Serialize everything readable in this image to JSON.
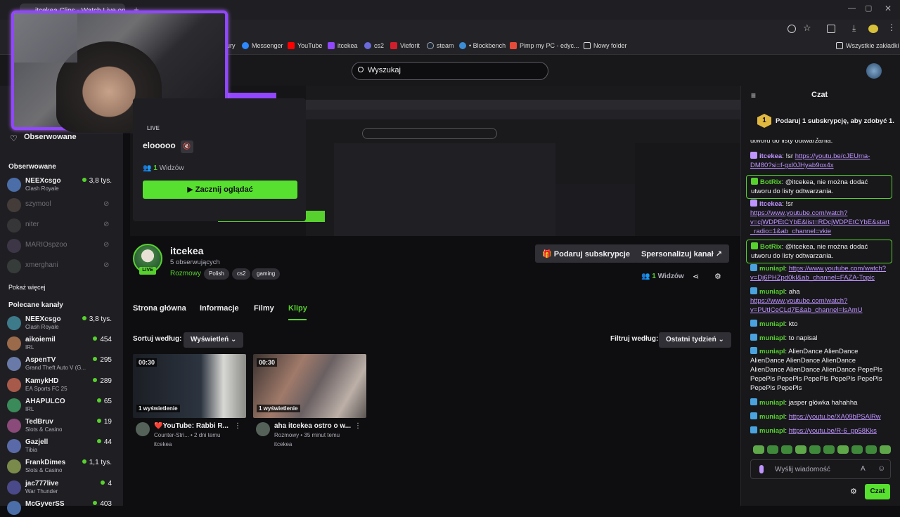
{
  "browser": {
    "tab_title": "itcekea Clips - Watch Live on K",
    "bookmarks": [
      "ury",
      "Messenger",
      "YouTube",
      "itcekea",
      "cs2",
      "Vieforit",
      "steam",
      "• Blockbench",
      "Pimp my PC - edyc...",
      "Nowy folder"
    ],
    "all_bookmarks": "Wszystkie zakładki"
  },
  "search": {
    "placeholder": "Wyszukaj"
  },
  "sidebar": {
    "followed_nav": "Obserwowane",
    "followed_header": "Obserwowane",
    "followed": [
      {
        "name": "NEEXcsgo",
        "category": "Clash Royale",
        "viewers": "3,8 tys.",
        "online": true
      },
      {
        "name": "szymool",
        "online": false
      },
      {
        "name": "niter",
        "online": false
      },
      {
        "name": "MARIOspzoo",
        "online": false
      },
      {
        "name": "xmerghani",
        "online": false
      }
    ],
    "show_more": "Pokaż więcej",
    "recommended_header": "Polecane kanały",
    "recommended": [
      {
        "name": "NEEXcsgo",
        "category": "Clash Royale",
        "viewers": "3,8 tys."
      },
      {
        "name": "aikoiemil",
        "category": "IRL",
        "viewers": "454"
      },
      {
        "name": "AspenTV",
        "category": "Grand Theft Auto V (G...",
        "viewers": "295"
      },
      {
        "name": "KamykHD",
        "category": "EA Sports FC 25",
        "viewers": "289"
      },
      {
        "name": "AHAPULCO",
        "category": "IRL",
        "viewers": "65"
      },
      {
        "name": "TedBruv",
        "category": "Slots & Casino",
        "viewers": "19"
      },
      {
        "name": "Gazjell",
        "category": "Tibia",
        "viewers": "44"
      },
      {
        "name": "FrankDimes",
        "category": "Slots & Casino",
        "viewers": "1,1 tys."
      },
      {
        "name": "jac777live",
        "category": "War Thunder",
        "viewers": "4"
      },
      {
        "name": "McGyverSS",
        "category": "",
        "viewers": "403"
      }
    ]
  },
  "popup": {
    "live": "LIVE",
    "title": "elooooo",
    "viewers_count": "1",
    "viewers_label": "Widzów",
    "watch_button": "Zacznij oglądać"
  },
  "channel": {
    "name": "itcekea",
    "followers": "5 obserwujących",
    "live_badge": "LIVE",
    "category": "Rozmowy",
    "tags": [
      "Polish",
      "cs2",
      "gaming"
    ],
    "gift_button": "Podaruj subskrypcje",
    "customize_button": "Spersonalizuj kanał",
    "viewers_count": "1",
    "viewers_label": "Widzów"
  },
  "tabs": [
    "Strona główna",
    "Informacje",
    "Filmy",
    "Klipy"
  ],
  "sort": {
    "label": "Sortuj według:",
    "value": "Wyświetleń"
  },
  "filter": {
    "label": "Filtruj według:",
    "value": "Ostatni tydzień"
  },
  "clips": [
    {
      "duration": "00:30",
      "views": "1 wyświetlenie",
      "title": "❤️YouTube: Rabbi R...",
      "meta": "Counter-Stri... • 2 dni temu",
      "channel": "itcekea"
    },
    {
      "duration": "00:30",
      "views": "1 wyświetlenie",
      "title": "aha itcekea ostro o w...",
      "meta": "Rozmowy • 35 minut temu",
      "channel": "itcekea"
    }
  ],
  "chat": {
    "title": "Czat",
    "sub_prompt": "Podaruj 1 subskrypcję, aby zdobyć 1.",
    "sub_count": "1",
    "top_cut": "utworu do listy odtwarzania.",
    "messages": [
      {
        "user": "itcekea",
        "sep": ": ",
        "text": "!sr ",
        "link": "https://youtu.be/cJEUma-DM80?si=f-gxl0JHyab9ox4x",
        "color": "#bf94ff",
        "bot": false
      },
      {
        "user": "BotRix",
        "sep": ": ",
        "text": "@itcekea, nie można dodać utworu do listy odtwarzania.",
        "link": "",
        "color": "#57d12e",
        "bot": true
      },
      {
        "user": "itcekea",
        "sep": ": ",
        "text": "!sr ",
        "link": "https://www.youtube.com/watch?v=cjWDPEtCYbE&list=RDcjWDPEtCYbE&start_radio=1&ab_channel=vkie",
        "color": "#bf94ff",
        "bot": false
      },
      {
        "user": "BotRix",
        "sep": ": ",
        "text": "@itcekea, nie można dodać utworu do listy odtwarzania.",
        "link": "",
        "color": "#57d12e",
        "bot": true
      },
      {
        "user": "muniapl",
        "sep": ": ",
        "text": "",
        "link": "https://www.youtube.com/watch?v=Dj6PHZpd0kI&ab_channel=FAZA-Topic",
        "color": "#57d12e",
        "bot": false
      },
      {
        "user": "muniapl",
        "sep": ": ",
        "text": "aha ",
        "link": "https://www.youtube.com/watch?v=PUtICeCLd7E&ab_channel=IsAmU",
        "color": "#57d12e",
        "bot": false
      },
      {
        "user": "muniapl",
        "sep": ": ",
        "text": "kto",
        "link": "",
        "color": "#57d12e",
        "bot": false
      },
      {
        "user": "muniapl",
        "sep": ": ",
        "text": "to napisal",
        "link": "",
        "color": "#57d12e",
        "bot": false
      },
      {
        "user": "muniapl",
        "sep": ": ",
        "text": "AlienDance AlienDance AlienDance AlienDance AlienDance AlienDance AlienDance AlienDance PepePls PepePls PepePls PepePls PepePls PepePls PepePls PepePls",
        "link": "",
        "color": "#57d12e",
        "bot": false
      },
      {
        "user": "muniapl",
        "sep": ": ",
        "text": "jasper główka hahahha",
        "link": "",
        "color": "#57d12e",
        "bot": false
      },
      {
        "user": "muniapl",
        "sep": ": ",
        "text": "",
        "link": "https://youtu.be/XA09bPSAlRw",
        "color": "#57d12e",
        "bot": false
      },
      {
        "user": "muniapl",
        "sep": ": ",
        "text": "",
        "link": "https://youtu.be/R-6_pp58Kks",
        "color": "#57d12e",
        "bot": false
      }
    ],
    "input_placeholder": "Wyślij wiadomość",
    "send_button": "Czat"
  },
  "colors": {
    "accent": "#57d12e",
    "purple": "#9147ff",
    "link": "#bf94ff"
  }
}
